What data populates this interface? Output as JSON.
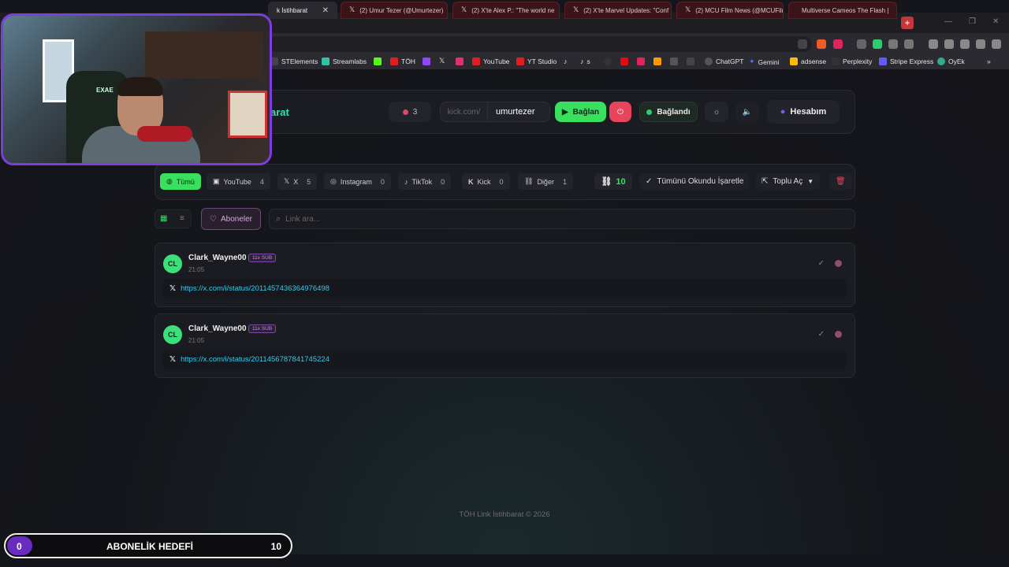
{
  "browser": {
    "tabs": [
      {
        "label": "k İstihbarat",
        "type": "active"
      },
      {
        "label": "(2) Umur Tezer (@Umurtezer)",
        "type": "x"
      },
      {
        "label": "(2) X'te Alex P.: \"The world ne",
        "type": "x"
      },
      {
        "label": "(2) X'te Marvel Updates: \"Conf",
        "type": "x"
      },
      {
        "label": "(2) MCU Film News (@MCUFilr",
        "type": "x"
      },
      {
        "label": "Multiverse Cameos The Flash |",
        "type": "youtube"
      }
    ],
    "new_tab": "+",
    "bookmarks": [
      {
        "label": "STElements",
        "color": "#444"
      },
      {
        "label": "Streamlabs",
        "color": "#31c3a2"
      },
      {
        "label": "",
        "color": "#53fc18"
      },
      {
        "label": "TÖH",
        "color": "#e41b23"
      },
      {
        "label": "",
        "color": "#9146ff"
      },
      {
        "label": "",
        "color": "#000"
      },
      {
        "label": "",
        "color": "#e1306c"
      },
      {
        "label": "YouTube",
        "color": "#e41b23"
      },
      {
        "label": "YT Studio",
        "color": "#e41b23"
      },
      {
        "label": "",
        "color": "#000"
      },
      {
        "label": "s",
        "color": "#000"
      },
      {
        "label": "",
        "color": "#333"
      },
      {
        "label": "",
        "color": "#e50914"
      },
      {
        "label": "",
        "color": "#e0245e"
      },
      {
        "label": "",
        "color": "#ff9900"
      },
      {
        "label": "",
        "color": "#555"
      },
      {
        "label": "",
        "color": "#444"
      },
      {
        "label": "ChatGPT",
        "color": "#555"
      },
      {
        "label": "Gemini",
        "color": "#4a7bf0"
      },
      {
        "label": "adsense",
        "color": "#fbbc04"
      },
      {
        "label": "Perplexity",
        "color": "#333"
      },
      {
        "label": "Stripe Express",
        "color": "#635bff"
      },
      {
        "label": "OyEk",
        "color": "#3a8"
      }
    ]
  },
  "header": {
    "brand": "arat",
    "viewer_count": "3",
    "kick_prefix": "kick.com/",
    "kick_username": "umurtezer",
    "connect_label": "Bağlan",
    "status_label": "Bağlandı",
    "account_label": "Hesabım"
  },
  "filters": {
    "tabs": [
      {
        "label": "Tümü",
        "count": ""
      },
      {
        "label": "YouTube",
        "count": "4"
      },
      {
        "label": "X",
        "count": "5"
      },
      {
        "label": "Instagram",
        "count": "0"
      },
      {
        "label": "TikTok",
        "count": "0"
      },
      {
        "label": "Kick",
        "count": "0"
      },
      {
        "label": "Diğer",
        "count": "1"
      }
    ],
    "link_count": "10",
    "mark_all_read": "Tümünü Okundu İşaretle",
    "bulk_open": "Toplu Aç"
  },
  "toolbar": {
    "subscribers_label": "Aboneler",
    "search_placeholder": "Link ara..."
  },
  "links": [
    {
      "initials": "CL",
      "username": "Clark_Wayne00",
      "badge": "11x SUB",
      "time": "21:05",
      "url": "https://x.com/i/status/2011457436364976498"
    },
    {
      "initials": "CL",
      "username": "Clark_Wayne00",
      "badge": "11x SUB",
      "time": "21:05",
      "url": "https://x.com/i/status/2011456787841745224"
    }
  ],
  "footer": "TÖH Link İstihbarat © 2026",
  "goal": {
    "current": "0",
    "title": "ABONELİK HEDEFİ",
    "target": "10"
  },
  "webcam": {
    "chair_text": "EXAE"
  },
  "colors": {
    "accent_green": "#39e05e",
    "brand_teal": "#3ce0b0",
    "link_cyan": "#3cc8e6",
    "danger": "#e8455c",
    "webcam_border": "#7a3ee0"
  }
}
